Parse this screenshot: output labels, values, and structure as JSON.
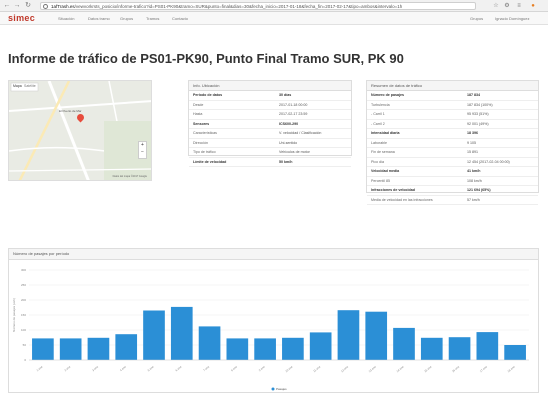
{
  "browser": {
    "url_domain": "1afTrash.es",
    "url_rest": "/vewvorkrsts_posicio/informe-trafico?id=PS01-PK90&tramo=SUR&punto=final&dias=30&fecha_inicio=2017-01-18&fecha_fin=2017-02-17&tipo=ambos&intervalo=1h"
  },
  "app": {
    "logo": "simec",
    "menu": [
      "Situación",
      "Datos tramo",
      "Grupos",
      "Tramos",
      "Contacto"
    ],
    "right_menu": [
      "Grupos",
      "Ignacio Domínguez"
    ]
  },
  "page": {
    "title": "Informe de tráfico de PS01-PK90, Punto Final Tramo SUR, PK 90"
  },
  "map": {
    "tab_label": "Mapa",
    "tab_label2": "Satélite",
    "marker_label": "El Puerto de Mar",
    "attribution": "Datos del mapa ©2017 Google",
    "zoom_in": "+",
    "zoom_out": "−"
  },
  "info": {
    "header": "Info. Ubicación",
    "rows": [
      {
        "k": "Periodo de datos",
        "v": "30 días",
        "bold": true
      },
      {
        "k": "Desde",
        "v": "2017-01-18 00:00"
      },
      {
        "k": "Hasta",
        "v": "2017-02-17 23:59"
      },
      {
        "k": "Sensores",
        "v": "ICS600-290",
        "bold": true
      },
      {
        "k": "Características",
        "v": "V. velocidad / Clasificación"
      },
      {
        "k": "Dirección",
        "v": "Uni-sentido"
      },
      {
        "k": "Tipo de tráfico",
        "v": "Vehículos de motor"
      },
      {
        "k": "Límite de velocidad",
        "v": "50 km/h",
        "bold": true
      }
    ]
  },
  "summary": {
    "header": "Resumen de datos de tráfico",
    "rows": [
      {
        "k": "Número de pasajes",
        "v": "187 834",
        "bold": true
      },
      {
        "k": "Turbulencia",
        "v": "187 834 (100%)"
      },
      {
        "k": "- Carril 1",
        "v": "95 933 (51%)"
      },
      {
        "k": "- Carril 2",
        "v": "92 001 (49%)"
      },
      {
        "k": "Intensidad diaria",
        "v": "18 396",
        "bold": true
      },
      {
        "k": "Laborable",
        "v": "9 105"
      },
      {
        "k": "Fin de semana",
        "v": "15 891"
      },
      {
        "k": "Pico día",
        "v": "12 454 (2017-02-04 00:00)"
      },
      {
        "k": "Velocidad media",
        "v": "41 km/h",
        "bold": true
      },
      {
        "k": "Percentil 85",
        "v": "108 km/h"
      },
      {
        "k": "Infracciones de velocidad",
        "v": "121 694 (65%)",
        "bold": true
      },
      {
        "k": "Media de velocidad en las infracciones",
        "v": "57 km/h"
      }
    ]
  },
  "chart_data": {
    "type": "bar",
    "title": "Número de pasajes por período",
    "ylabel": "Número de pasajes (veh)",
    "legend": "Pasajes",
    "legend_position": "bottom",
    "color": "#2b8fd6",
    "grid": true,
    "ylim": [
      0,
      300
    ],
    "yticks": [
      "300",
      "250",
      "200",
      "150",
      "100",
      "50",
      "0"
    ],
    "categories": [
      "1 ene",
      "2 ene",
      "3 ene",
      "4 ene",
      "5 ene",
      "6 ene",
      "7 ene",
      "8 ene",
      "9 ene",
      "10 ene",
      "11 ene",
      "12 ene",
      "13 ene",
      "14 ene",
      "15 ene",
      "16 ene",
      "17 ene",
      "18 ene"
    ],
    "values": [
      72,
      72,
      74,
      86,
      165,
      177,
      112,
      72,
      72,
      74,
      92,
      166,
      161,
      107,
      74,
      76,
      93,
      50
    ]
  }
}
